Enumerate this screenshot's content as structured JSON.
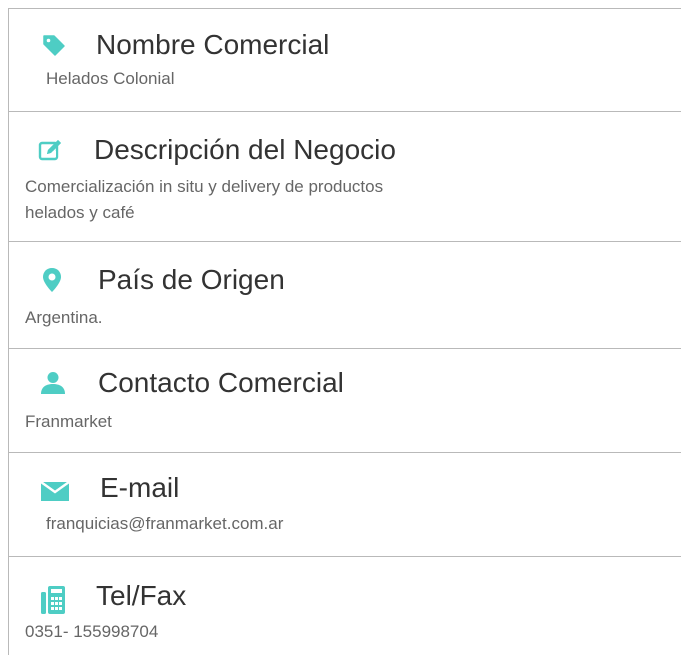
{
  "accent_color": "#4ecdc4",
  "fields": [
    {
      "icon": "tag-icon",
      "label": "Nombre Comercial",
      "value": "Helados Colonial"
    },
    {
      "icon": "edit-icon",
      "label": "Descripción del Negocio",
      "value": "Comercialización in situ y delivery de productos\nhelados y café"
    },
    {
      "icon": "location-pin-icon",
      "label": "País de Origen",
      "value": "Argentina."
    },
    {
      "icon": "user-icon",
      "label": "Contacto Comercial",
      "value": "Franmarket"
    },
    {
      "icon": "envelope-icon",
      "label": "E-mail",
      "value": "franquicias@franmarket.com.ar"
    },
    {
      "icon": "fax-icon",
      "label": "Tel/Fax",
      "value": "0351- 155998704"
    }
  ]
}
